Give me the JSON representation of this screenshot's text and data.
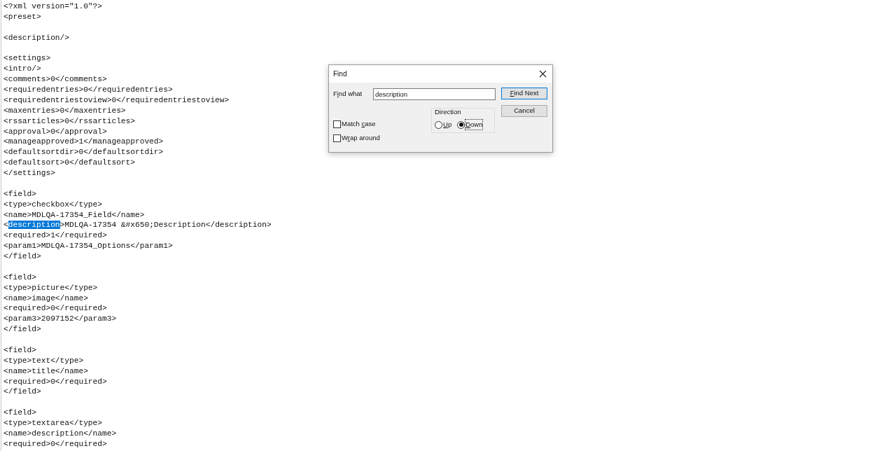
{
  "editor": {
    "lines": [
      {
        "kind": "text",
        "text": "<?xml version=\"1.0\"?>"
      },
      {
        "kind": "text",
        "text": "<preset>"
      },
      {
        "kind": "blank"
      },
      {
        "kind": "text",
        "text": "<description/>"
      },
      {
        "kind": "blank"
      },
      {
        "kind": "text",
        "text": "<settings>"
      },
      {
        "kind": "text",
        "text": "<intro/>"
      },
      {
        "kind": "text",
        "text": "<comments>0</comments>"
      },
      {
        "kind": "text",
        "text": "<requiredentries>0</requiredentries>"
      },
      {
        "kind": "text",
        "text": "<requiredentriestoview>0</requiredentriestoview>"
      },
      {
        "kind": "text",
        "text": "<maxentries>0</maxentries>"
      },
      {
        "kind": "text",
        "text": "<rssarticles>0</rssarticles>"
      },
      {
        "kind": "text",
        "text": "<approval>0</approval>"
      },
      {
        "kind": "text",
        "text": "<manageapproved>1</manageapproved>"
      },
      {
        "kind": "text",
        "text": "<defaultsortdir>0</defaultsortdir>"
      },
      {
        "kind": "text",
        "text": "<defaultsort>0</defaultsort>"
      },
      {
        "kind": "text",
        "text": "</settings>"
      },
      {
        "kind": "blank"
      },
      {
        "kind": "text",
        "text": "<field>"
      },
      {
        "kind": "text",
        "text": "<type>checkbox</type>"
      },
      {
        "kind": "text",
        "text": "<name>MDLQA-17354_Field</name>"
      },
      {
        "kind": "parts",
        "parts": [
          {
            "text": "<",
            "selected": false
          },
          {
            "text": "description",
            "selected": true
          },
          {
            "text": ">MDLQA-17354 &#x650;Description</description>",
            "selected": false
          }
        ]
      },
      {
        "kind": "text",
        "text": "<required>1</required>"
      },
      {
        "kind": "text",
        "text": "<param1>MDLQA-17354_Options</param1>"
      },
      {
        "kind": "text",
        "text": "</field>"
      },
      {
        "kind": "blank"
      },
      {
        "kind": "text",
        "text": "<field>"
      },
      {
        "kind": "text",
        "text": "<type>picture</type>"
      },
      {
        "kind": "text",
        "text": "<name>image</name>"
      },
      {
        "kind": "text",
        "text": "<required>0</required>"
      },
      {
        "kind": "text",
        "text": "<param3>2097152</param3>"
      },
      {
        "kind": "text",
        "text": "</field>"
      },
      {
        "kind": "blank"
      },
      {
        "kind": "text",
        "text": "<field>"
      },
      {
        "kind": "text",
        "text": "<type>text</type>"
      },
      {
        "kind": "text",
        "text": "<name>title</name>"
      },
      {
        "kind": "text",
        "text": "<required>0</required>"
      },
      {
        "kind": "text",
        "text": "</field>"
      },
      {
        "kind": "blank"
      },
      {
        "kind": "text",
        "text": "<field>"
      },
      {
        "kind": "text",
        "text": "<type>textarea</type>"
      },
      {
        "kind": "text",
        "text": "<name>description</name>"
      },
      {
        "kind": "text",
        "text": "<required>0</required>"
      }
    ]
  },
  "find_dialog": {
    "title": "Find",
    "find_what": {
      "label": {
        "before": "F",
        "key": "i",
        "after": "nd what"
      },
      "value": "description"
    },
    "buttons": [
      {
        "label": {
          "key": "F",
          "after": "ind Next"
        },
        "default": true
      },
      {
        "label": {
          "before": "Cancel"
        },
        "default": false
      }
    ],
    "direction": {
      "title": "Direction",
      "options": [
        {
          "label": {
            "key": "U",
            "after": "p"
          },
          "selected": false
        },
        {
          "label": {
            "key": "D",
            "after": "own"
          },
          "selected": true
        }
      ]
    },
    "options": [
      {
        "label": {
          "before": "Match ",
          "key": "c",
          "after": "ase"
        },
        "checked": false
      },
      {
        "label": {
          "before": "W",
          "key": "r",
          "after": "ap around"
        },
        "checked": false
      }
    ]
  }
}
